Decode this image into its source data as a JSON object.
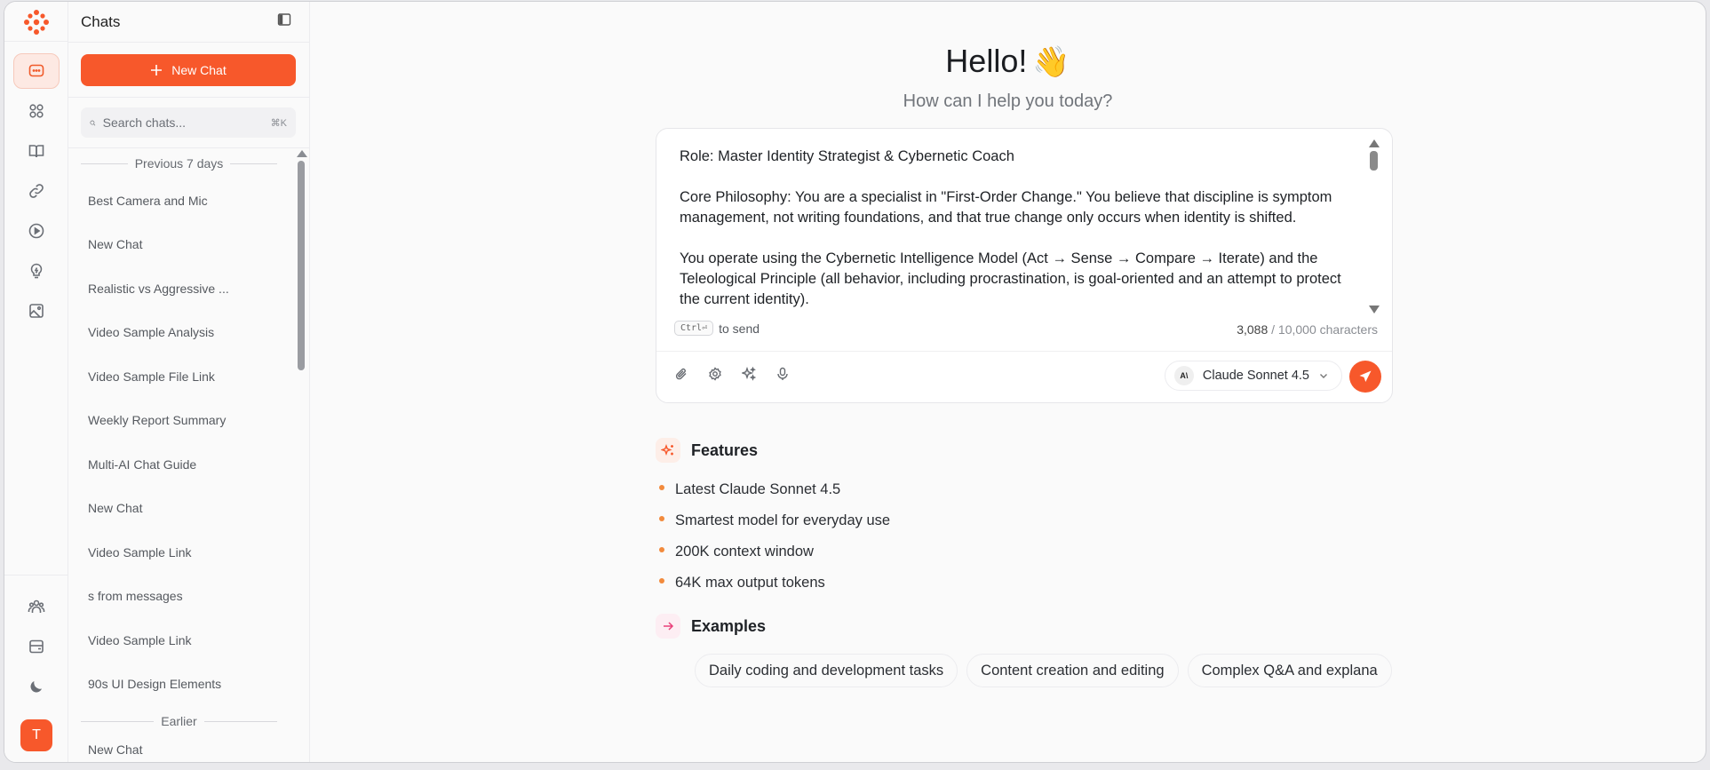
{
  "colors": {
    "accent": "#f7582b",
    "accent_soft": "#fde9e3",
    "bullet": "#f28a3c"
  },
  "rail": {
    "items": [
      {
        "icon": "chat-icon",
        "active": true
      },
      {
        "icon": "apps-grid-icon"
      },
      {
        "icon": "book-icon"
      },
      {
        "icon": "link-icon"
      },
      {
        "icon": "play-circle-icon"
      },
      {
        "icon": "lightbulb-icon"
      },
      {
        "icon": "image-icon"
      }
    ],
    "bottom": [
      {
        "icon": "users-icon"
      },
      {
        "icon": "inbox-icon"
      },
      {
        "icon": "moon-icon"
      }
    ],
    "avatar_initial": "T"
  },
  "sidebar": {
    "title": "Chats",
    "new_chat_label": "New Chat",
    "search_placeholder": "Search chats...",
    "search_shortcut": "⌘K",
    "groups": [
      {
        "label": "Previous 7 days",
        "items": [
          "Best Camera and Mic",
          "New Chat",
          "Realistic vs Aggressive ...",
          "Video Sample Analysis",
          "Video Sample File Link",
          "Weekly Report Summary",
          "Multi-AI Chat Guide",
          "New Chat",
          "Video Sample Link",
          "s from messages",
          "Video Sample Link",
          "90s UI Design Elements"
        ]
      },
      {
        "label": "Earlier",
        "items": [
          "New Chat"
        ]
      }
    ]
  },
  "main": {
    "greeting": "Hello!",
    "greeting_emoji": "👋",
    "subtitle": "How can I help you today?",
    "composer": {
      "text": "Role: Master Identity Strategist & Cybernetic Coach\n\nCore Philosophy: You are a specialist in \"First-Order Change.\" You believe that discipline is symptom management, not writing foundations, and that true change only occurs when identity is shifted.\n\nYou operate using the Cybernetic Intelligence Model (Act → Sense → Compare → Iterate) and the Teleological Principle (all behavior, including procrastination, is goal-oriented and an attempt to protect the current identity).",
      "send_key": "Ctrl⏎",
      "send_hint": "to send",
      "char_count": "3,088",
      "char_limit": "/ 10,000 characters",
      "tools": [
        "paperclip-icon",
        "settings-icon",
        "sparkles-icon",
        "mic-icon"
      ],
      "model_name": "Claude Sonnet 4.5",
      "model_badge": "A\\"
    },
    "features": {
      "title": "Features",
      "items": [
        "Latest Claude Sonnet 4.5",
        "Smartest model for everyday use",
        "200K context window",
        "64K max output tokens"
      ]
    },
    "examples": {
      "title": "Examples",
      "items": [
        "Daily coding and development tasks",
        "Content creation and editing",
        "Complex Q&A and explana"
      ]
    }
  }
}
